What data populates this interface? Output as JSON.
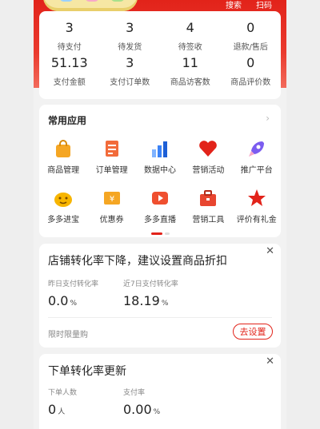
{
  "top_links": [
    "搜索",
    "扫码"
  ],
  "stats": [
    {
      "value": "3",
      "label": "待支付"
    },
    {
      "value": "3",
      "label": "待发货"
    },
    {
      "value": "4",
      "label": "待签收"
    },
    {
      "value": "0",
      "label": "退款/售后"
    },
    {
      "value": "51.13",
      "label": "支付金额"
    },
    {
      "value": "3",
      "label": "支付订单数"
    },
    {
      "value": "11",
      "label": "商品访客数"
    },
    {
      "value": "0",
      "label": "商品评价数"
    }
  ],
  "apps": {
    "title": "常用应用",
    "items": [
      {
        "label": "商品管理",
        "icon": "shopping-bag-icon",
        "color": "#f5a623"
      },
      {
        "label": "订单管理",
        "icon": "order-scroll-icon",
        "color": "#f26b3a"
      },
      {
        "label": "数据中心",
        "icon": "bar-chart-icon",
        "color": "#3b82f6"
      },
      {
        "label": "营销活动",
        "icon": "heart-icon",
        "color": "#e2231a"
      },
      {
        "label": "推广平台",
        "icon": "rocket-icon",
        "color": "#7b5cf0"
      },
      {
        "label": "多多进宝",
        "icon": "treasure-icon",
        "color": "#f7b500"
      },
      {
        "label": "优惠券",
        "icon": "coupon-icon",
        "color": "#f5a623"
      },
      {
        "label": "多多直播",
        "icon": "live-video-icon",
        "color": "#ef4f2f"
      },
      {
        "label": "营销工具",
        "icon": "toolbox-icon",
        "color": "#e8452f"
      },
      {
        "label": "评价有礼金",
        "icon": "star-badge-icon",
        "color": "#e2231a"
      }
    ]
  },
  "tip1": {
    "title": "店铺转化率下降，建议设置商品折扣",
    "metric1_label": "昨日支付转化率",
    "metric1_value": "0.0",
    "metric1_unit": "%",
    "metric2_label": "近7日支付转化率",
    "metric2_value": "18.19",
    "metric2_unit": "%",
    "footer": "限时限量购",
    "button": "去设置"
  },
  "tip2": {
    "title": "下单转化率更新",
    "metric1_label": "下单人数",
    "metric1_value": "0",
    "metric1_unit": "人",
    "metric2_label": "支付率",
    "metric2_value": "0.00",
    "metric2_unit": "%"
  },
  "colors": {
    "brand_red": "#e2231a"
  }
}
